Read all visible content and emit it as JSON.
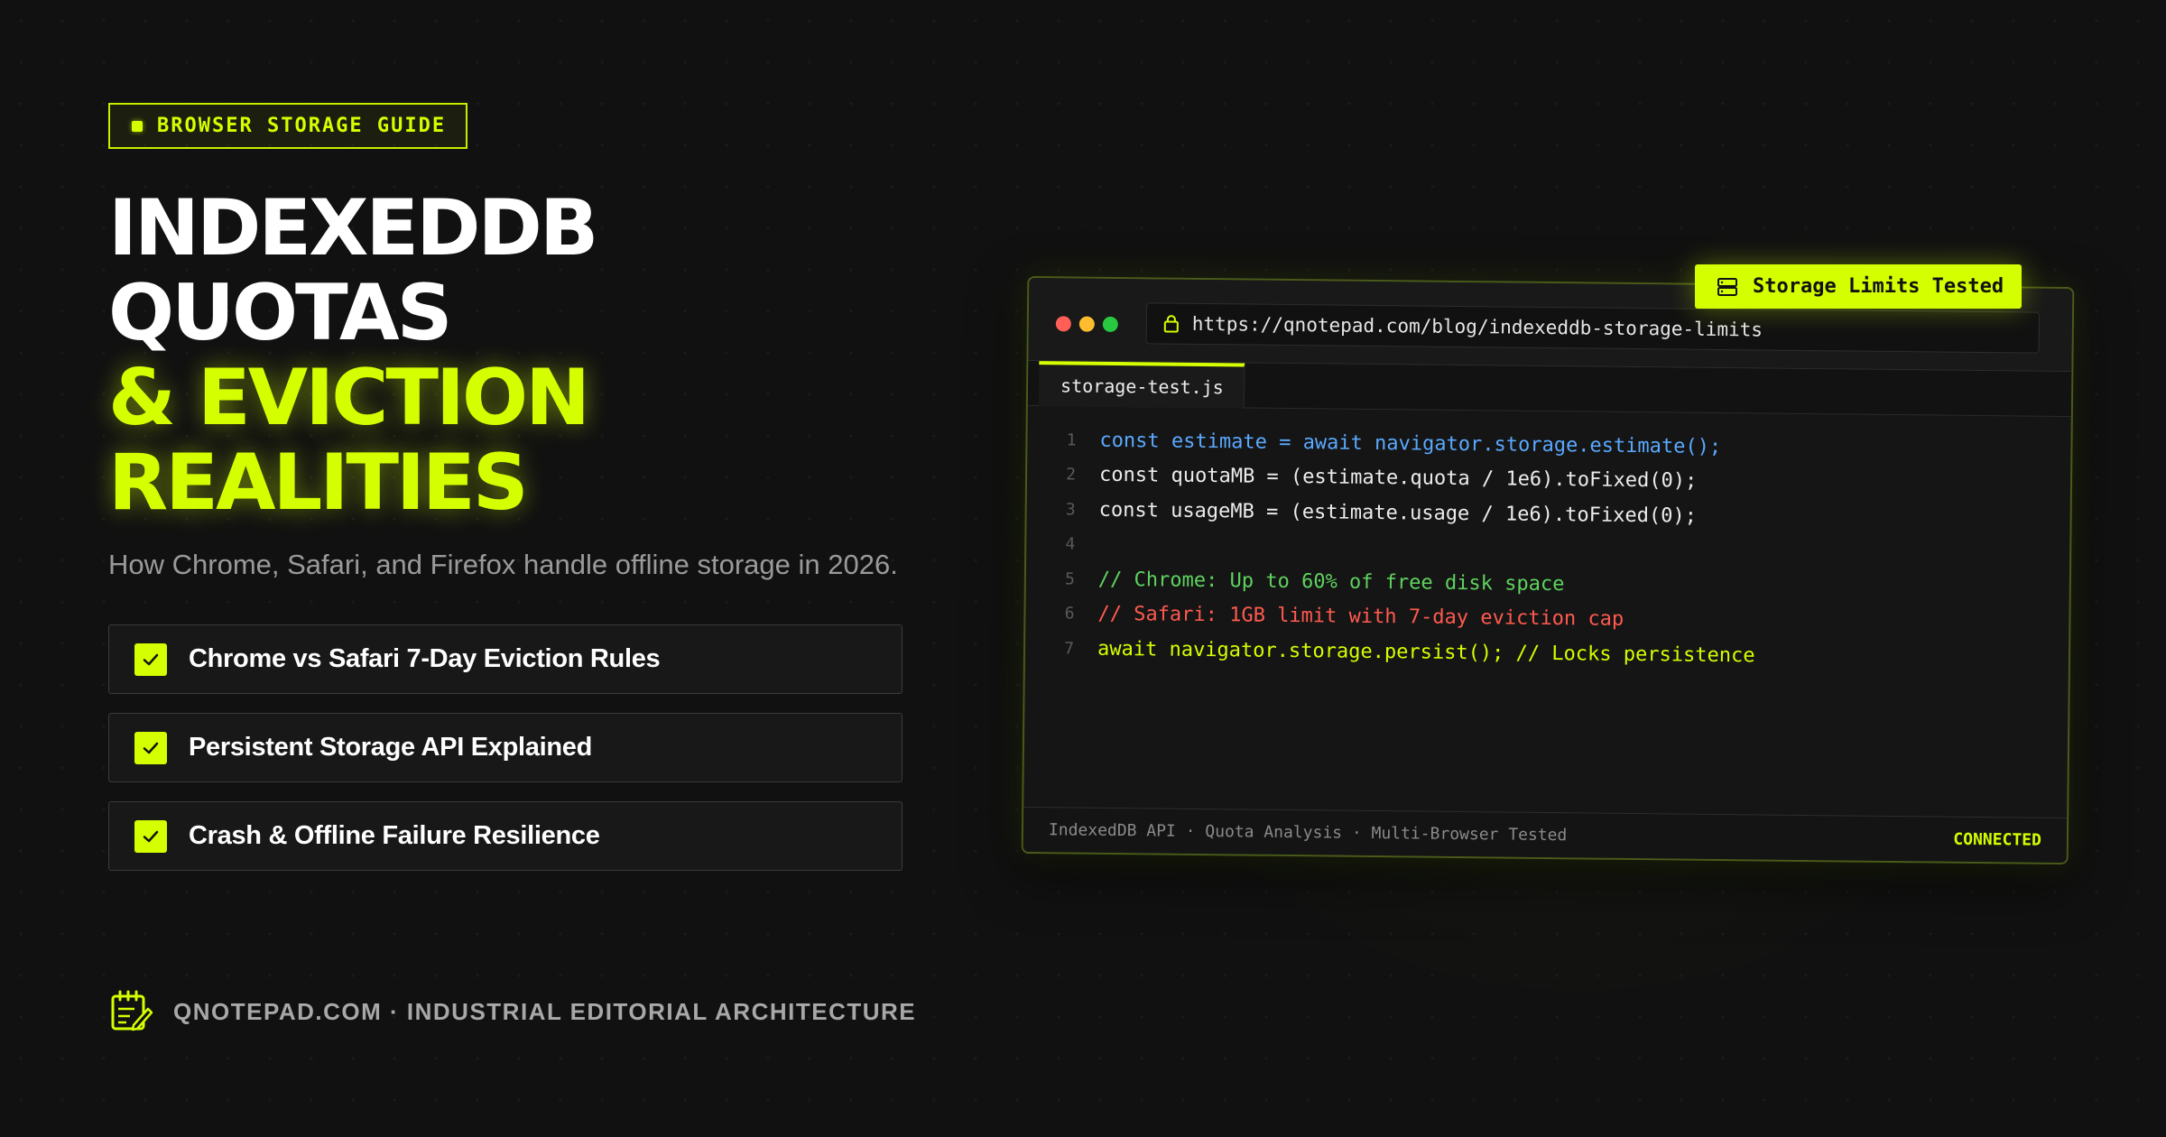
{
  "badge": {
    "label": "BROWSER STORAGE GUIDE"
  },
  "headline": {
    "line1": "INDEXEDDB",
    "line2": "QUOTAS",
    "line3": "& EVICTION",
    "line4": "REALITIES"
  },
  "subtitle": "How Chrome, Safari, and Firefox handle offline storage in 2026.",
  "features": [
    {
      "label": "Chrome vs Safari 7-Day Eviction Rules"
    },
    {
      "label": "Persistent Storage API Explained"
    },
    {
      "label": "Crash & Offline Failure Resilience"
    }
  ],
  "footer": {
    "text": "QNOTEPAD.COM · INDUSTRIAL EDITORIAL ARCHITECTURE",
    "icon": "notepad-pencil-icon"
  },
  "floating_badge": {
    "label": "Storage Limits Tested",
    "icon": "server-stack-icon"
  },
  "browser": {
    "url": "https://qnotepad.com/blog/indexeddb-storage-limits",
    "tab": "storage-test.js",
    "code": [
      {
        "n": "1",
        "text": "const estimate = await navigator.storage.estimate();"
      },
      {
        "n": "2",
        "text": "const quotaMB = (estimate.quota / 1e6).toFixed(0);"
      },
      {
        "n": "3",
        "text": "const usageMB = (estimate.usage / 1e6).toFixed(0);"
      },
      {
        "n": "4",
        "text": ""
      },
      {
        "n": "5",
        "text": "// Chrome: Up to 60% of free disk space"
      },
      {
        "n": "6",
        "text": "// Safari: 1GB limit with 7-day eviction cap"
      },
      {
        "n": "7",
        "text": "await navigator.storage.persist(); // Locks persistence"
      }
    ],
    "status_left": "IndexedDB API · Quota Analysis · Multi-Browser Tested",
    "status_right": "CONNECTED"
  },
  "colors": {
    "accent": "#d4ff00",
    "background": "#111111",
    "code_blue": "#5aa9ff",
    "code_green": "#5ed35e",
    "code_red": "#ff5a4f"
  }
}
